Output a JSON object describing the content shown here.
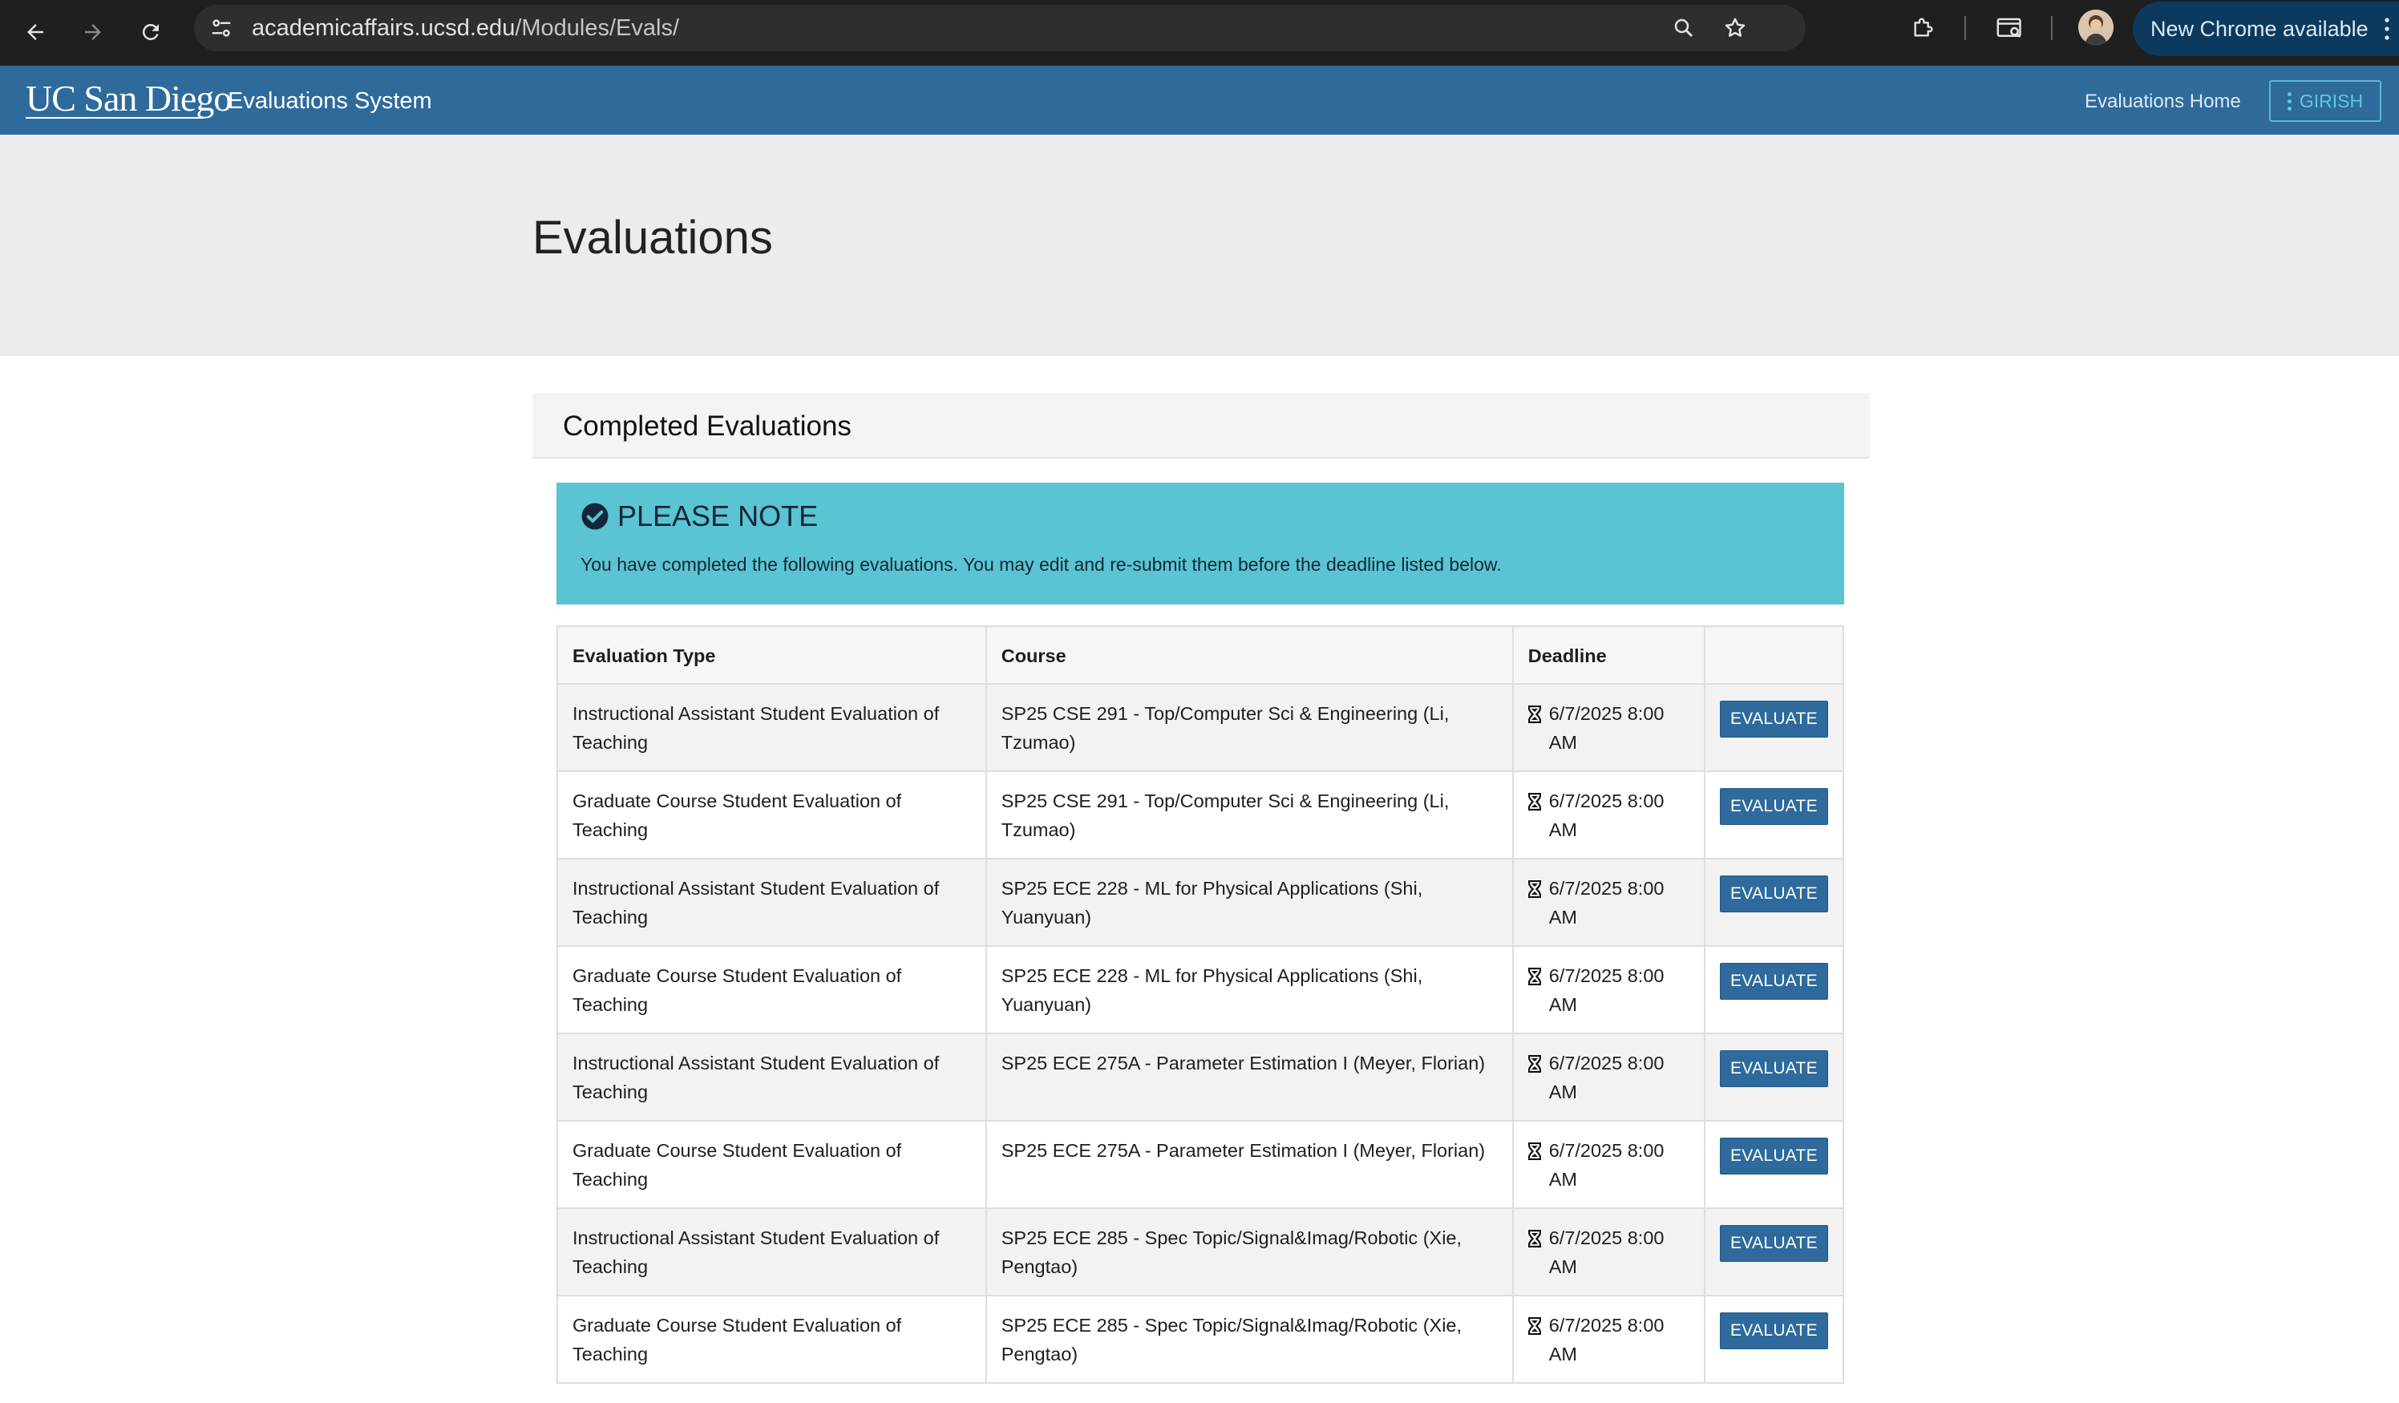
{
  "browser": {
    "url_host": "academicaffairs.ucsd.edu",
    "url_path": "/Modules/Evals/",
    "update_label": "New Chrome available"
  },
  "site": {
    "logo_text": "UC San Diego",
    "system_title": "Evaluations System",
    "nav_home": "Evaluations Home",
    "user_label": "GIRISH"
  },
  "page": {
    "title": "Evaluations"
  },
  "panel": {
    "heading": "Completed Evaluations",
    "alert_title": "PLEASE NOTE",
    "alert_message": "You have completed the following evaluations. You may edit and re-submit them before the deadline listed below."
  },
  "table": {
    "headers": [
      "Evaluation Type",
      "Course",
      "Deadline",
      ""
    ],
    "button_label": "EVALUATE",
    "rows": [
      {
        "type": "Instructional Assistant Student Evaluation of Teaching",
        "course": "SP25 CSE 291 - Top/Computer Sci & Engineering (Li, Tzumao)",
        "deadline": "6/7/2025 8:00 AM"
      },
      {
        "type": "Graduate Course Student Evaluation of Teaching",
        "course": "SP25 CSE 291 - Top/Computer Sci & Engineering (Li, Tzumao)",
        "deadline": "6/7/2025 8:00 AM"
      },
      {
        "type": "Instructional Assistant Student Evaluation of Teaching",
        "course": "SP25 ECE 228 - ML for Physical Applications (Shi, Yuanyuan)",
        "deadline": "6/7/2025 8:00 AM"
      },
      {
        "type": "Graduate Course Student Evaluation of Teaching",
        "course": "SP25 ECE 228 - ML for Physical Applications (Shi, Yuanyuan)",
        "deadline": "6/7/2025 8:00 AM"
      },
      {
        "type": "Instructional Assistant Student Evaluation of Teaching",
        "course": "SP25 ECE 275A - Parameter Estimation I (Meyer, Florian)",
        "deadline": "6/7/2025 8:00 AM"
      },
      {
        "type": "Graduate Course Student Evaluation of Teaching",
        "course": "SP25 ECE 275A - Parameter Estimation I (Meyer, Florian)",
        "deadline": "6/7/2025 8:00 AM"
      },
      {
        "type": "Instructional Assistant Student Evaluation of Teaching",
        "course": "SP25 ECE 285 - Spec Topic/Signal&Imag/Robotic (Xie, Pengtao)",
        "deadline": "6/7/2025 8:00 AM"
      },
      {
        "type": "Graduate Course Student Evaluation of Teaching",
        "course": "SP25 ECE 285 - Spec Topic/Signal&Imag/Robotic (Xie, Pengtao)",
        "deadline": "6/7/2025 8:00 AM"
      }
    ]
  },
  "colors": {
    "header_blue": "#2e6a9b",
    "alert_teal": "#5bc4d3",
    "button_blue": "#2e6a9b"
  },
  "icons": [
    "back-arrow-icon",
    "forward-arrow-icon",
    "reload-icon",
    "site-settings-icon",
    "zoom-icon",
    "bookmark-star-icon",
    "extensions-icon",
    "tab-search-icon",
    "profile-avatar",
    "kebab-menu-icon",
    "check-circle-icon",
    "hourglass-icon"
  ]
}
